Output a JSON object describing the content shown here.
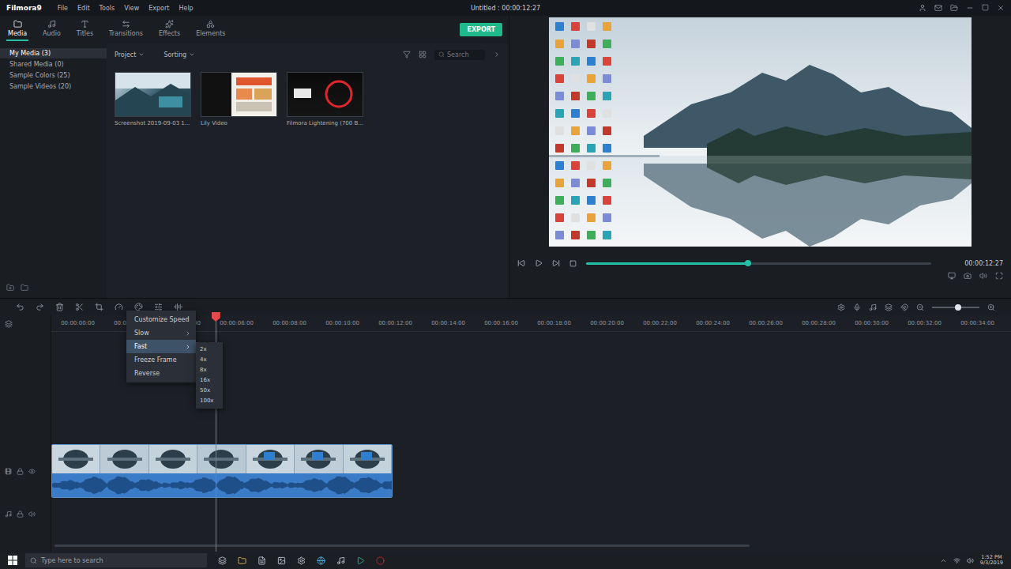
{
  "app": {
    "logo": "Filmora9",
    "menu": [
      "File",
      "Edit",
      "Tools",
      "View",
      "Export",
      "Help"
    ],
    "title": "Untitled : 00:00:12:27"
  },
  "library_tabs": [
    {
      "label": "Media",
      "selected": true
    },
    {
      "label": "Audio",
      "selected": false
    },
    {
      "label": "Titles",
      "selected": false
    },
    {
      "label": "Transitions",
      "selected": false
    },
    {
      "label": "Effects",
      "selected": false
    },
    {
      "label": "Elements",
      "selected": false
    }
  ],
  "export_button": "EXPORT",
  "sidebar": {
    "items": [
      {
        "label": "My Media (3)",
        "selected": true
      },
      {
        "label": "Shared Media (0)",
        "selected": false
      },
      {
        "label": "Sample Colors (25)",
        "selected": false
      },
      {
        "label": "Sample Videos (20)",
        "selected": false
      }
    ]
  },
  "media_toolbar": {
    "filters": [
      "Project",
      "Sorting"
    ],
    "search": {
      "placeholder": "Search"
    }
  },
  "media_items": [
    {
      "label": "Screenshot 2019-09-03 1..."
    },
    {
      "label": "Lily Video"
    },
    {
      "label": "Filmora Lightening (700 B..."
    }
  ],
  "preview": {
    "time": "00:00:12:27",
    "level": 0.47
  },
  "timeline": {
    "ruler": [
      "00:00:00:00",
      "00:00:02:00",
      "00:00:04:00",
      "00:00:06:00",
      "00:00:08:00",
      "00:00:10:00",
      "00:00:12:00",
      "00:00:14:00",
      "00:00:16:00",
      "00:00:18:00",
      "00:00:20:00",
      "00:00:22:00",
      "00:00:24:00",
      "00:00:26:00",
      "00:00:28:00",
      "00:00:30:00",
      "00:00:32:00",
      "00:00:34:00"
    ],
    "playhead": 0.171,
    "zoom": 0.55
  },
  "context_menu": [
    {
      "label": "Customize Speed",
      "kind": "action",
      "selected": false
    },
    {
      "label": "Slow",
      "kind": "submenu",
      "selected": false
    },
    {
      "label": "Fast",
      "kind": "submenu",
      "selected": true
    },
    {
      "label": "Freeze Frame",
      "kind": "action",
      "selected": false
    },
    {
      "label": "Reverse",
      "kind": "action",
      "selected": false
    }
  ],
  "speed_submenu": [
    "2x",
    "4x",
    "8x",
    "16x",
    "50x",
    "100x"
  ],
  "taskbar": {
    "search": "Type here to search",
    "time": "1:52 PM",
    "date": "9/3/2019"
  }
}
